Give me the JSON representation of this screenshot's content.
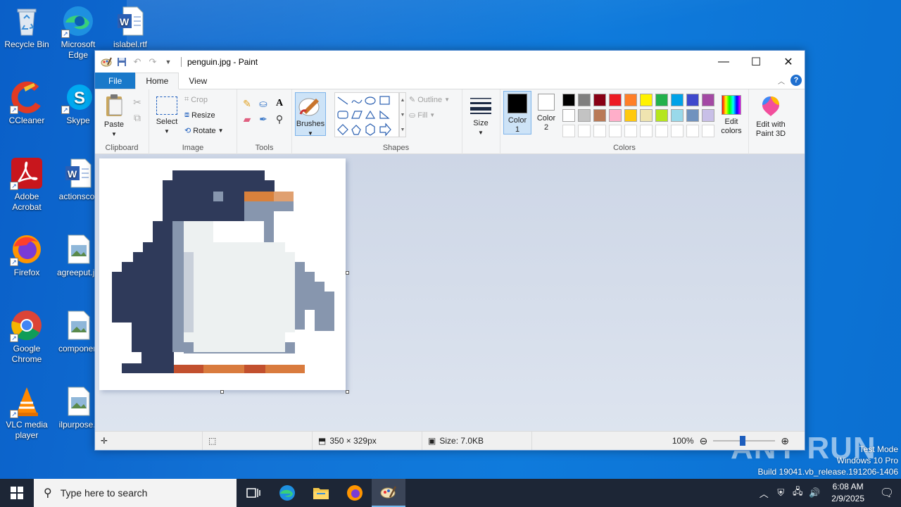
{
  "desktop": {
    "icons": [
      {
        "label": "Recycle Bin"
      },
      {
        "label": "Microsoft\nEdge"
      },
      {
        "label": "islabel.rtf"
      },
      {
        "label": "CCleaner"
      },
      {
        "label": "Skype"
      },
      {
        "label": "Adobe\nAcrobat"
      },
      {
        "label": "actionscor"
      },
      {
        "label": "Firefox"
      },
      {
        "label": "agreeput.jp"
      },
      {
        "label": "Google\nChrome"
      },
      {
        "label": "componen"
      },
      {
        "label": "VLC media\nplayer"
      },
      {
        "label": "ilpurpose.j"
      }
    ]
  },
  "window": {
    "title": "penguin.jpg - Paint",
    "controls": {
      "minimize": "—",
      "maximize": "☐",
      "close": "✕"
    }
  },
  "tabs": {
    "file": "File",
    "home": "Home",
    "view": "View"
  },
  "ribbon": {
    "clipboard": {
      "paste": "Paste",
      "label": "Clipboard"
    },
    "image": {
      "select": "Select",
      "crop": "Crop",
      "resize": "Resize",
      "rotate": "Rotate",
      "label": "Image"
    },
    "tools": {
      "label": "Tools"
    },
    "brushes": {
      "label": "Brushes"
    },
    "shapes": {
      "outline": "Outline",
      "fill": "Fill",
      "label": "Shapes"
    },
    "size": {
      "label": "Size"
    },
    "colors": {
      "color1": "Color\n1",
      "color2": "Color\n2",
      "edit_colors": "Edit\ncolors",
      "edit_paint3d": "Edit with\nPaint 3D",
      "label": "Colors",
      "palette_row1": [
        "#000000",
        "#7f7f7f",
        "#880015",
        "#ed1c24",
        "#ff7f27",
        "#fff200",
        "#22b14c",
        "#00a2e8",
        "#3f48cc",
        "#a349a4"
      ],
      "palette_row2": [
        "#ffffff",
        "#c3c3c3",
        "#b97a57",
        "#ffaec9",
        "#ffc90e",
        "#efe4b0",
        "#b5e61d",
        "#99d9ea",
        "#7092be",
        "#c8bfe7"
      ]
    }
  },
  "status": {
    "dimensions": "350 × 329px",
    "size": "Size: 7.0KB",
    "zoom": "100%"
  },
  "taskbar": {
    "search_placeholder": "Type here to search",
    "time": "6:08 AM",
    "date": "2/9/2025"
  },
  "watermark": {
    "line1": "Test Mode",
    "line2": "Windows 10 Pro",
    "line3": "Build 19041.vb_release.191206-1406",
    "brand": "ANY RUN"
  }
}
